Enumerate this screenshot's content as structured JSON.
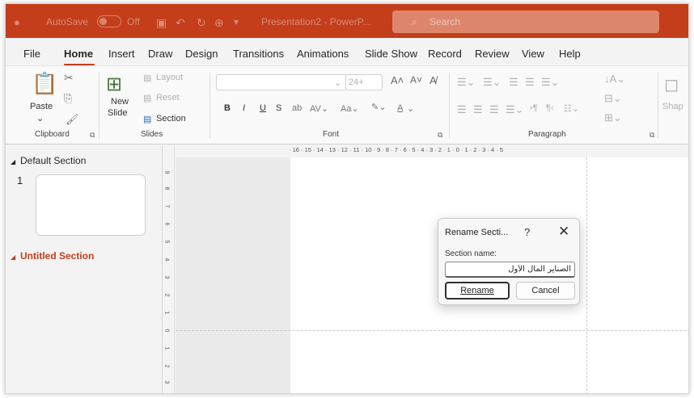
{
  "titlebar": {
    "autosave_label": "AutoSave",
    "autosave_state": "Off",
    "doc_title": "Presentation2 - PowerP...",
    "search_placeholder": "Search"
  },
  "tabs": [
    "File",
    "Home",
    "Insert",
    "Draw",
    "Design",
    "Transitions",
    "Animations",
    "Slide Show",
    "Record",
    "Review",
    "View",
    "Help"
  ],
  "active_tab": "Home",
  "ribbon": {
    "clipboard": {
      "paste": "Paste",
      "group": "Clipboard"
    },
    "slides": {
      "new_slide_line1": "New",
      "new_slide_line2": "Slide",
      "layout": "Layout",
      "reset": "Reset",
      "section": "Section",
      "group": "Slides"
    },
    "font": {
      "size": "24+",
      "bold": "B",
      "italic": "I",
      "underline": "U",
      "strike": "S",
      "group": "Font"
    },
    "paragraph": {
      "group": "Paragraph"
    },
    "shapes": "Shap"
  },
  "thumbpane": {
    "default_section": "Default Section",
    "slide_number": "1",
    "untitled_section": "Untitled Section"
  },
  "ruler": {
    "horizontal": "· 16 · 15 · 14 · 13 · 12 · 11 · 10 · 9 · 8 · 7 · 6 · 5 · 4 · 3 · 2 · 1 · 0 · 1 · 2 · 3 · 4 · 5",
    "vertical": [
      "9",
      "8",
      "7",
      "6",
      "5",
      "4",
      "3",
      "2",
      "1",
      "0",
      "1",
      "2",
      "3"
    ]
  },
  "dialog": {
    "title": "Rename Secti...",
    "help": "?",
    "close": "✕",
    "label": "Section name:",
    "input_value": "الصناير المال الأول",
    "rename_button": "Rename",
    "cancel_button": "Cancel"
  },
  "colors": {
    "accent": "#c43e1c",
    "untitled_section": "#c43e1c"
  }
}
